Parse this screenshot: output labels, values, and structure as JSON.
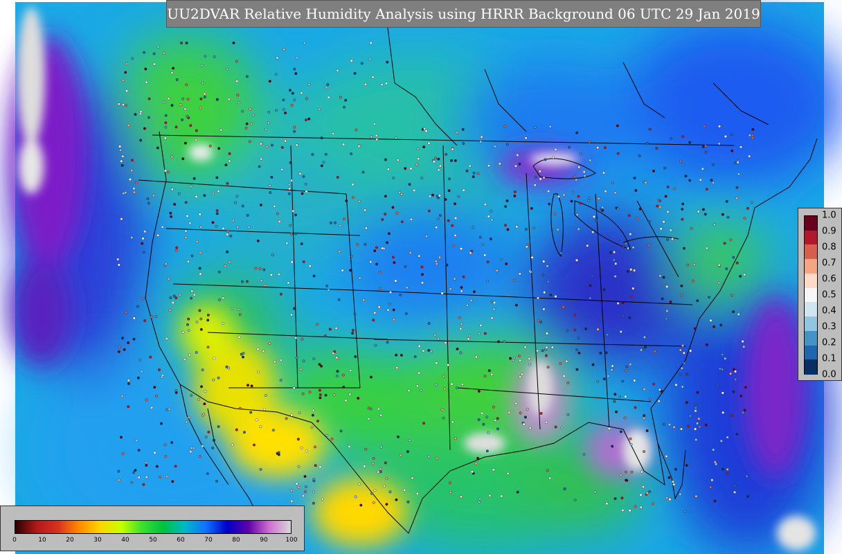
{
  "title": "UU2DVAR Relative Humidity Analysis using HRRR Background 06 UTC 29 Jan 2019",
  "rh_legend": {
    "ticks": [
      "0",
      "10",
      "20",
      "30",
      "40",
      "50",
      "60",
      "70",
      "80",
      "90",
      "100"
    ],
    "colors": [
      "#2a0000",
      "#b01818",
      "#d83020",
      "#ff8a00",
      "#ffd400",
      "#c8ff00",
      "#38e030",
      "#00c040",
      "#00b8c8",
      "#1070ff",
      "#0000c8",
      "#6000a8",
      "#d070d0",
      "#d8d8d8"
    ]
  },
  "increment_legend": {
    "labels": [
      "1.0",
      "0.9",
      "0.8",
      "0.7",
      "0.6",
      "0.5",
      "0.4",
      "0.3",
      "0.2",
      "0.1",
      "0.0"
    ],
    "colors": [
      "#67001f",
      "#b2182b",
      "#d6604d",
      "#f4a582",
      "#fddbc7",
      "#f7f7f7",
      "#d1e5f0",
      "#92c5de",
      "#4393c3",
      "#2166ac",
      "#053061"
    ]
  }
}
